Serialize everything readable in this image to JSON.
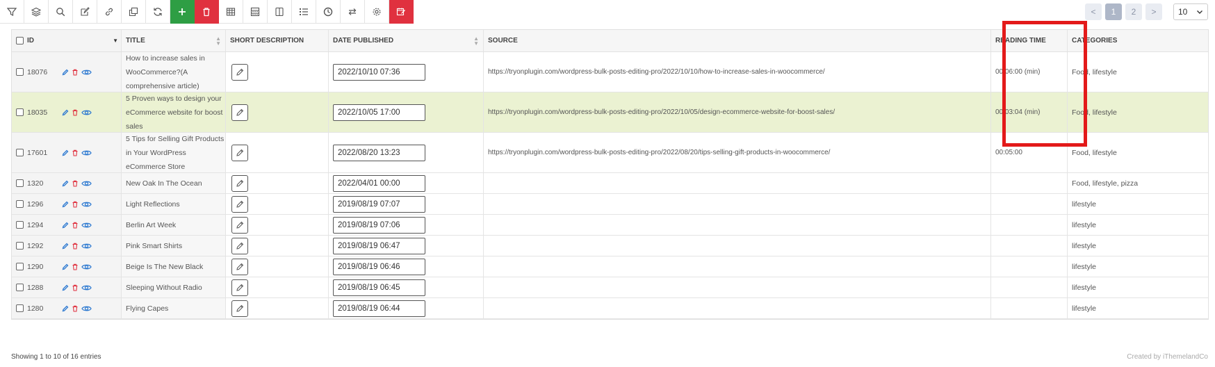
{
  "toolbar": {
    "buttons": [
      {
        "icon": "filter-icon"
      },
      {
        "icon": "layers-icon"
      },
      {
        "icon": "search-icon"
      },
      {
        "icon": "edit-icon"
      },
      {
        "icon": "link-icon"
      },
      {
        "icon": "duplicate-icon"
      },
      {
        "icon": "refresh-icon"
      },
      {
        "icon": "add-icon"
      },
      {
        "icon": "delete-icon"
      },
      {
        "icon": "table-icon"
      },
      {
        "icon": "grid-icon"
      },
      {
        "icon": "columns-icon"
      },
      {
        "icon": "list-icon"
      },
      {
        "icon": "history-icon"
      },
      {
        "icon": "swap-icon"
      },
      {
        "icon": "settings-icon"
      },
      {
        "icon": "bulk-edit-icon"
      }
    ],
    "accent_green": "#2e9e44",
    "accent_red": "#e0313f"
  },
  "pagination": {
    "prev": "<",
    "pages": [
      "1",
      "2"
    ],
    "next": ">",
    "per_page": "10"
  },
  "table": {
    "headers": {
      "id": "ID",
      "title": "TITLE",
      "short_description": "SHORT DESCRIPTION",
      "date_published": "DATE PUBLISHED",
      "source": "SOURCE",
      "reading_time": "READING TIME",
      "categories": "CATEGORIES"
    },
    "rows": [
      {
        "id": "18076",
        "title": "How to increase sales in WooCommerce?(A comprehensive article)",
        "date": "2022/10/10 07:36",
        "source": "https://tryonplugin.com/wordpress-bulk-posts-editing-pro/2022/10/10/how-to-increase-sales-in-woocommerce/",
        "reading_time": "00:06:00 (min)",
        "categories": "Food, lifestyle"
      },
      {
        "id": "18035",
        "title": "5 Proven ways to design your eCommerce website for boost sales",
        "date": "2022/10/05 17:00",
        "source": "https://tryonplugin.com/wordpress-bulk-posts-editing-pro/2022/10/05/design-ecommerce-website-for-boost-sales/",
        "reading_time": "00:03:04 (min)",
        "categories": "Food, lifestyle"
      },
      {
        "id": "17601",
        "title": "5 Tips for Selling Gift Products in Your WordPress eCommerce Store",
        "date": "2022/08/20 13:23",
        "source": "https://tryonplugin.com/wordpress-bulk-posts-editing-pro/2022/08/20/tips-selling-gift-products-in-woocommerce/",
        "reading_time": "00:05:00",
        "categories": "Food, lifestyle"
      },
      {
        "id": "1320",
        "title": "New Oak In The Ocean",
        "date": "2022/04/01 00:00",
        "source": "",
        "reading_time": "",
        "categories": "Food, lifestyle, pizza"
      },
      {
        "id": "1296",
        "title": "Light Reflections",
        "date": "2019/08/19 07:07",
        "source": "",
        "reading_time": "",
        "categories": "lifestyle"
      },
      {
        "id": "1294",
        "title": "Berlin Art Week",
        "date": "2019/08/19 07:06",
        "source": "",
        "reading_time": "",
        "categories": "lifestyle"
      },
      {
        "id": "1292",
        "title": "Pink Smart Shirts",
        "date": "2019/08/19 06:47",
        "source": "",
        "reading_time": "",
        "categories": "lifestyle"
      },
      {
        "id": "1290",
        "title": "Beige Is The New Black",
        "date": "2019/08/19 06:46",
        "source": "",
        "reading_time": "",
        "categories": "lifestyle"
      },
      {
        "id": "1288",
        "title": "Sleeping Without Radio",
        "date": "2019/08/19 06:45",
        "source": "",
        "reading_time": "",
        "categories": "lifestyle"
      },
      {
        "id": "1280",
        "title": "Flying Capes",
        "date": "2019/08/19 06:44",
        "source": "",
        "reading_time": "",
        "categories": "lifestyle"
      }
    ],
    "highlight_color": "#ebf2d2"
  },
  "footer": {
    "entries": "Showing 1 to 10 of 16 entries",
    "credit": "Created by iThemelandCo"
  }
}
